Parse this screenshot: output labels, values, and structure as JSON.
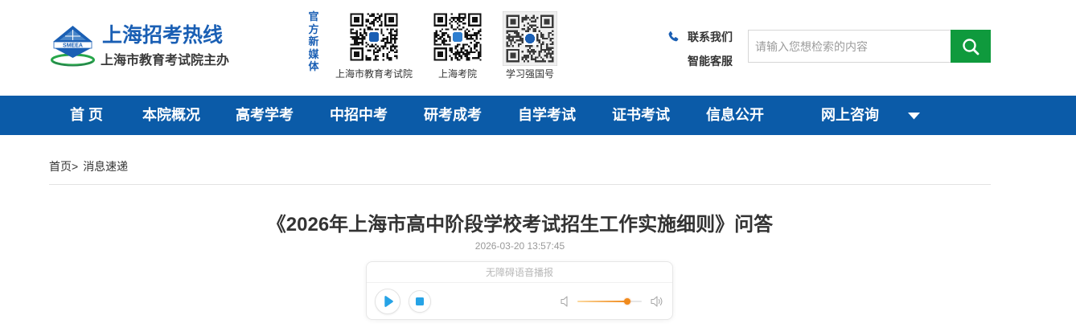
{
  "header": {
    "logo": {
      "mark_text": "SMEEA",
      "title": "上海招考热线",
      "subtitle": "上海市教育考试院主办"
    },
    "media_label": "官方新媒体",
    "qr_codes": [
      {
        "label": "上海市教育考试院",
        "icon": "qr-code-icon"
      },
      {
        "label": "上海考院",
        "icon": "qr-code-icon"
      },
      {
        "label": "学习强国号",
        "icon": "qr-code-icon"
      }
    ],
    "contact": {
      "icon": "phone-icon",
      "label": "联系我们"
    },
    "service": {
      "label": "智能客服"
    },
    "search": {
      "placeholder": "请输入您想检索的内容",
      "value": "",
      "button_icon": "search-icon"
    }
  },
  "nav": {
    "items": [
      "首 页",
      "本院概况",
      "高考学考",
      "中招中考",
      "研考成考",
      "自学考试",
      "证书考试",
      "信息公开",
      "网上咨询"
    ],
    "more_icon": "caret-down-icon"
  },
  "breadcrumb": {
    "items": [
      "首页",
      "消息速递"
    ],
    "separator": ">"
  },
  "article": {
    "title": "《2026年上海市高中阶段学校考试招生工作实施细则》问答",
    "date": "2026-03-20 13:57:45"
  },
  "audio_player": {
    "title": "无障碍语音播报",
    "play_icon": "play-icon",
    "stop_icon": "stop-icon",
    "volume_low_icon": "volume-low-icon",
    "volume_high_icon": "volume-high-icon",
    "volume": 0.78
  },
  "colors": {
    "brand_blue": "#1a5fb4",
    "nav_background": "#0b5ba8",
    "search_button": "#0f9a3d",
    "player_accent": "#26a3e6",
    "volume_fill": "#f08a1c"
  }
}
